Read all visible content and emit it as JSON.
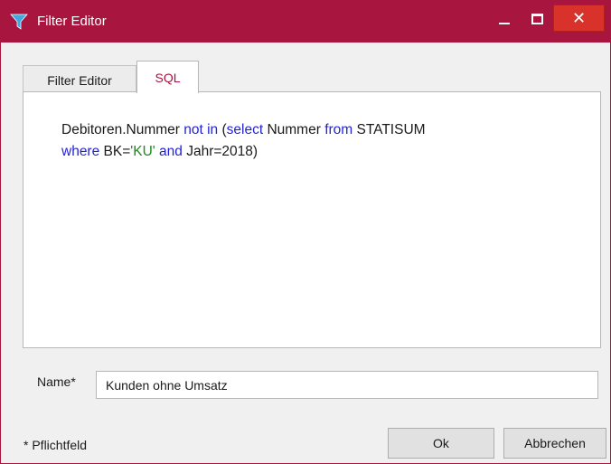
{
  "window": {
    "title": "Filter Editor",
    "accent_color": "#a8153f",
    "icons": {
      "app": "filter-funnel-icon",
      "minimize": "minimize-icon",
      "maximize": "maximize-icon",
      "close": "close-icon"
    },
    "close_glyph": "✕"
  },
  "tabs": [
    {
      "label": "Filter Editor",
      "active": false
    },
    {
      "label": "SQL",
      "active": true
    }
  ],
  "sql": {
    "tokens": [
      {
        "text": "Debitoren.Nummer ",
        "type": "plain"
      },
      {
        "text": "not in",
        "type": "keyword"
      },
      {
        "text": " (",
        "type": "plain"
      },
      {
        "text": "select",
        "type": "keyword"
      },
      {
        "text": " Nummer ",
        "type": "plain"
      },
      {
        "text": "from",
        "type": "keyword"
      },
      {
        "text": " STATISUM",
        "type": "plain"
      },
      {
        "text": "where",
        "type": "keyword"
      },
      {
        "text": " BK=",
        "type": "plain"
      },
      {
        "text": "'KU'",
        "type": "string"
      },
      {
        "text": " ",
        "type": "plain"
      },
      {
        "text": "and",
        "type": "keyword"
      },
      {
        "text": " Jahr=2018)",
        "type": "plain"
      }
    ],
    "keyword_color": "#2323d6",
    "string_color": "#1c8a1c"
  },
  "name_field": {
    "label": "Name*",
    "value": "Kunden ohne Umsatz"
  },
  "footer": {
    "required_note": "* Pflichtfeld",
    "ok_label": "Ok",
    "cancel_label": "Abbrechen"
  }
}
